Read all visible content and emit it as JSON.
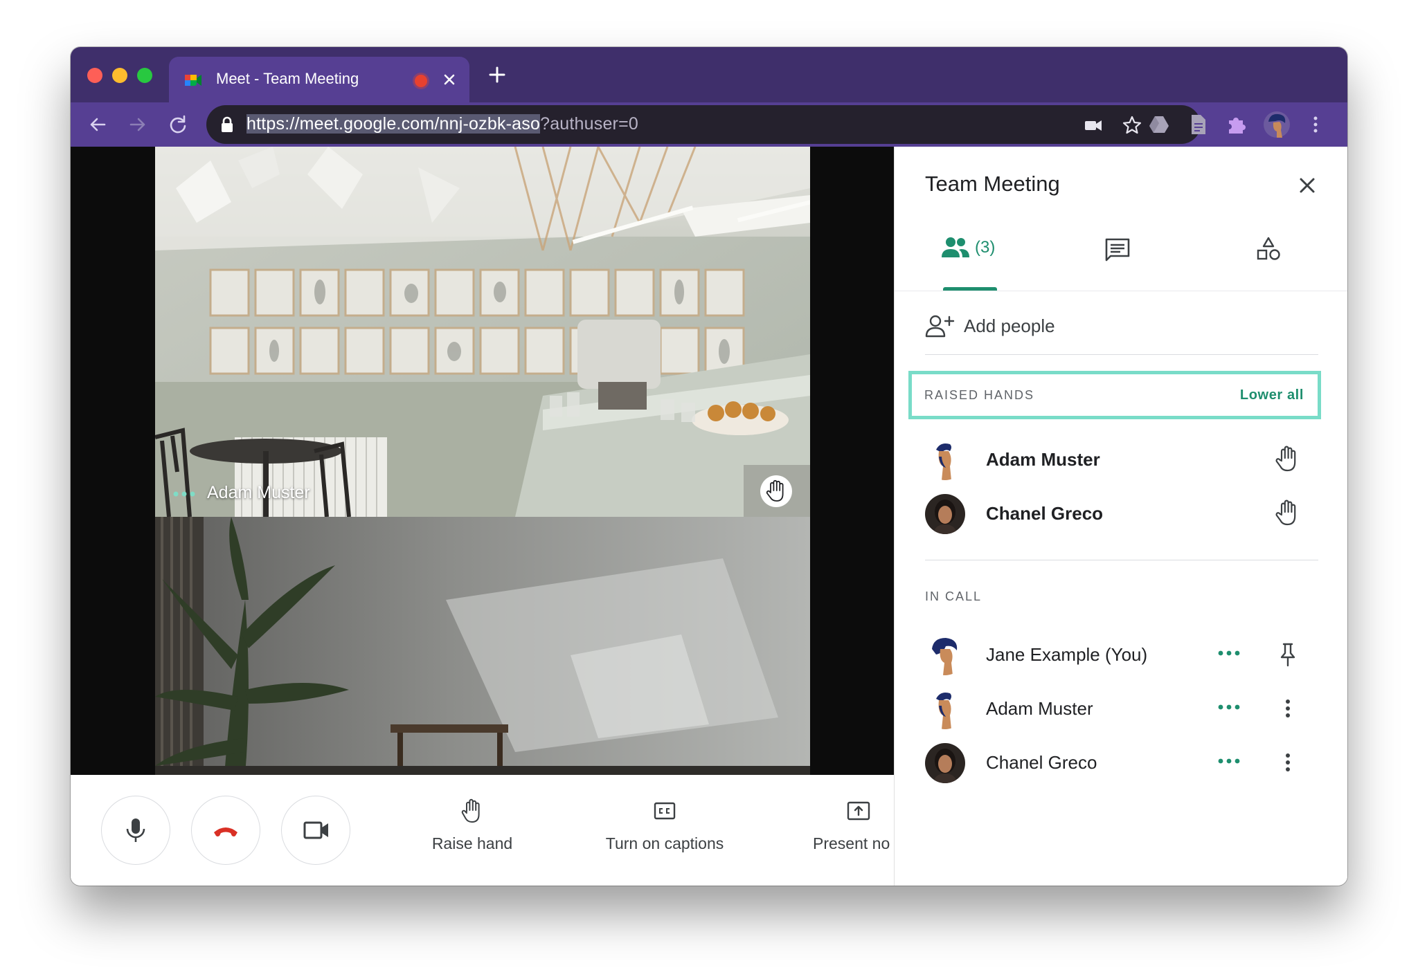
{
  "browser": {
    "tab_title": "Meet - Team Meeting",
    "url_selected": "https://meet.google.com/nnj-ozbk-aso",
    "url_rest": "?authuser=0"
  },
  "video": {
    "tile_1_name": "Adam Muster"
  },
  "controls": {
    "raise_hand": "Raise hand",
    "captions": "Turn on captions",
    "present": "Present no"
  },
  "panel": {
    "title": "Team Meeting",
    "people_count": "(3)",
    "add_people": "Add people",
    "raised_hands_title": "RAISED HANDS",
    "lower_all": "Lower all",
    "raised_hands": [
      {
        "name": "Adam Muster"
      },
      {
        "name": "Chanel Greco"
      }
    ],
    "in_call_title": "IN CALL",
    "in_call": [
      {
        "name": "Jane Example (You)"
      },
      {
        "name": "Adam Muster"
      },
      {
        "name": "Chanel Greco"
      }
    ]
  },
  "colors": {
    "tabstrip": "#3f2f6b",
    "toolbar": "#563f93",
    "accent_green": "#1e8e6e",
    "highlight_box": "#79dcc8",
    "end_call_red": "#d93025"
  },
  "icons": {
    "people_tab": "people-icon",
    "chat_tab": "chat-icon",
    "activities_tab": "shapes-icon",
    "hand": "raise-hand-icon",
    "pin": "pin-icon",
    "more": "kebab-icon"
  }
}
